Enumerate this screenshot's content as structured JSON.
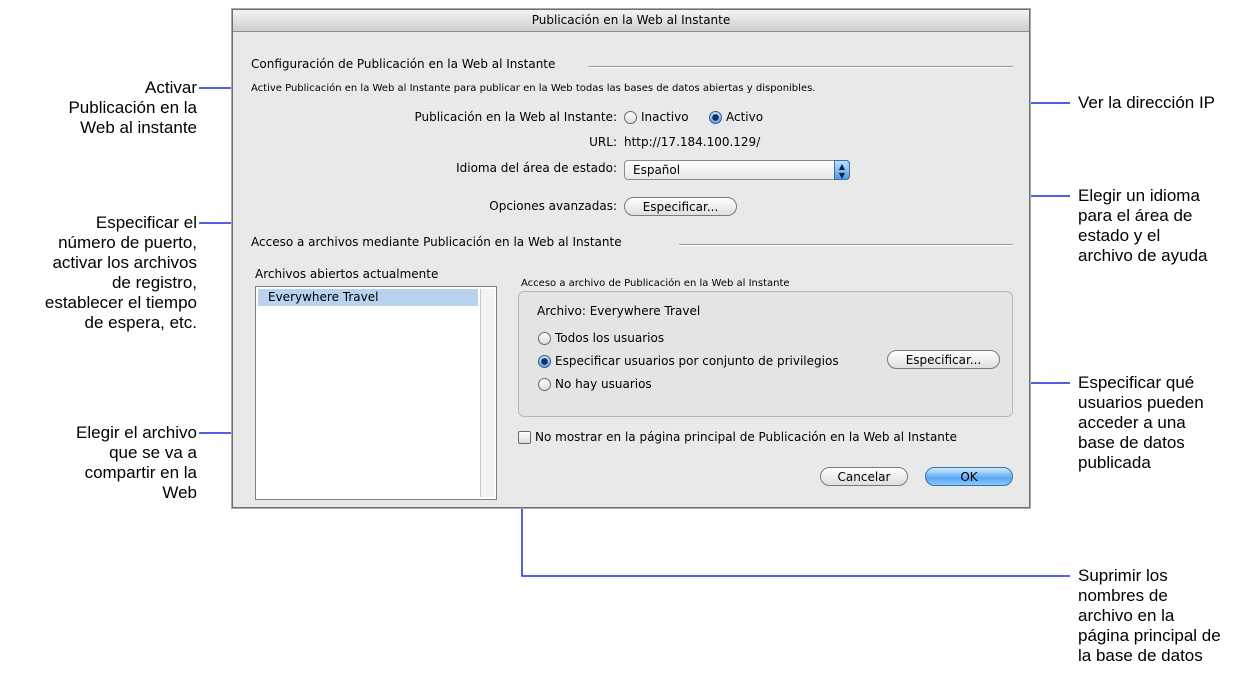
{
  "window": {
    "title": "Publicación en la Web al Instante"
  },
  "config_section": {
    "heading": "Configuración de Publicación en la Web al Instante",
    "description": "Active Publicación en la Web al Instante para publicar en la Web todas las bases de datos abiertas y disponibles.",
    "iwp_label": "Publicación en la Web al Instante:",
    "radio_inactive": "Inactivo",
    "radio_active": "Activo",
    "selected_state": "Activo",
    "url_label": "URL:",
    "url_value": "http://17.184.100.129/",
    "language_label": "Idioma del área de estado:",
    "language_value": "Español",
    "advanced_label": "Opciones avanzadas:",
    "advanced_button": "Especificar..."
  },
  "access_section": {
    "heading": "Acceso a archivos mediante Publicación en la Web al Instante",
    "open_files_label": "Archivos abiertos actualmente",
    "open_files": [
      "Everywhere Travel"
    ],
    "group_title": "Acceso a archivo de Publicación en la Web al Instante",
    "file_label": "Archivo: Everywhere Travel",
    "options": [
      {
        "label": "Todos los usuarios",
        "selected": false
      },
      {
        "label": "Especificar usuarios por conjunto de privilegios",
        "selected": true
      },
      {
        "label": "No hay usuarios",
        "selected": false
      }
    ],
    "specify_button": "Especificar...",
    "hide_checkbox_label": "No mostrar en la página principal de Publicación en la Web al Instante",
    "hide_checked": false
  },
  "buttons": {
    "cancel": "Cancelar",
    "ok": "OK"
  },
  "callouts": {
    "left": [
      [
        "Activar",
        "Publicación en la",
        "Web al instante"
      ],
      [
        "Especificar el",
        "número de puerto,",
        "activar los archivos",
        "de registro,",
        "establecer el tiempo",
        "de espera, etc."
      ],
      [
        "Elegir el archivo",
        "que se va a",
        "compartir en la",
        "Web"
      ]
    ],
    "right": [
      [
        "Ver la dirección IP"
      ],
      [
        "Elegir un idioma",
        "para el área de",
        "estado y el",
        "archivo de ayuda"
      ],
      [
        "Especificar qué",
        "usuarios pueden",
        "acceder a una",
        "base de datos",
        "publicada"
      ],
      [
        "Suprimir los",
        "nombres de",
        "archivo en la",
        "página principal de",
        "la base de datos"
      ]
    ]
  },
  "colors": {
    "callout_line": "#1a2fd0",
    "default_button": "#57a8f2"
  }
}
